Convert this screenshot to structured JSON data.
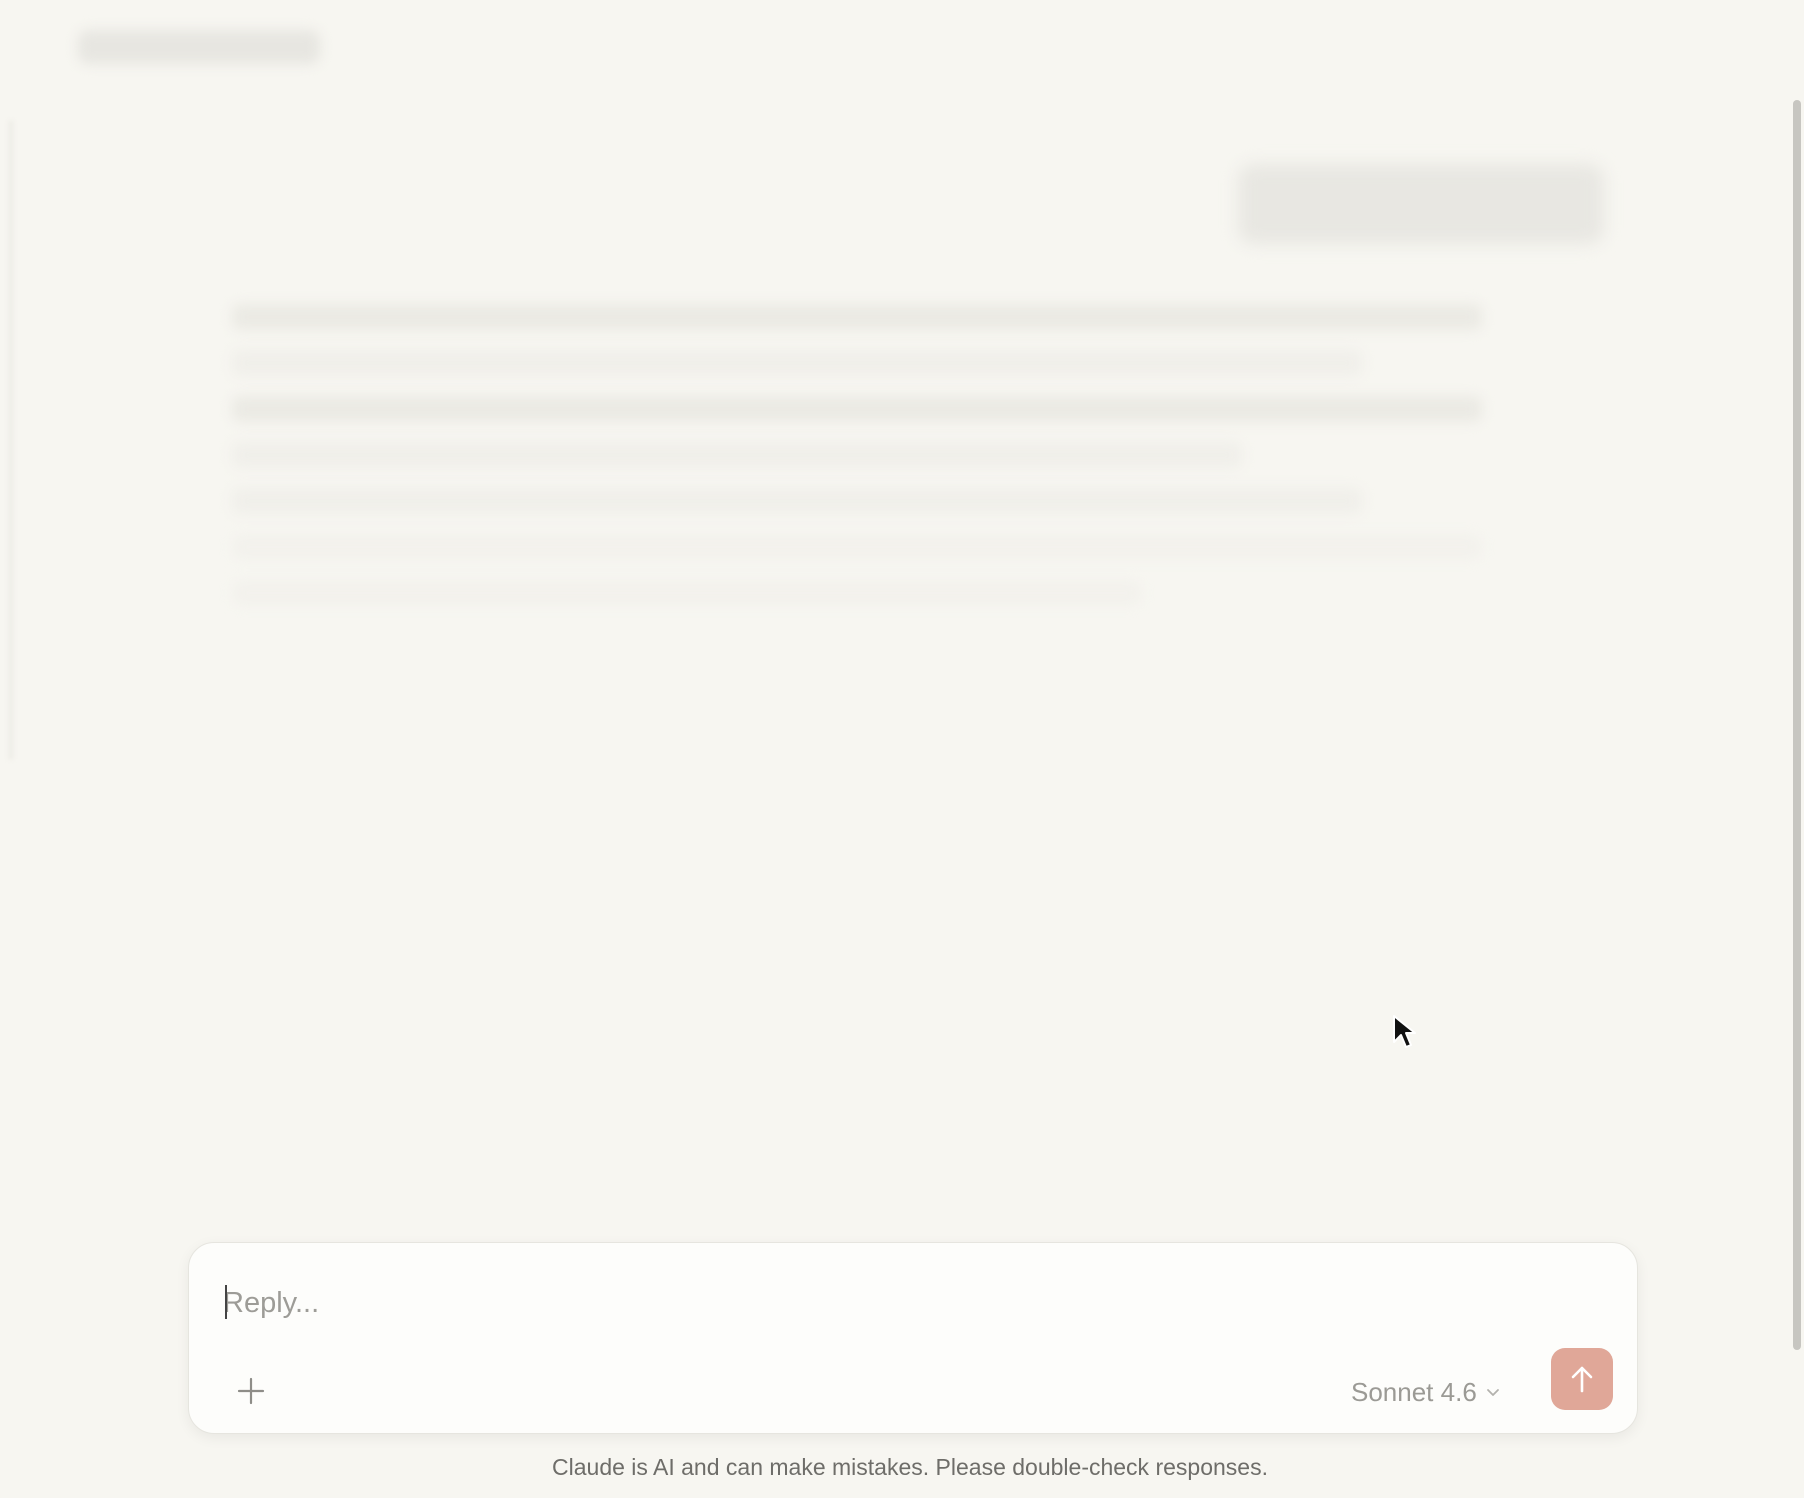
{
  "composer": {
    "placeholder": "Reply...",
    "value": "",
    "model_label": "Sonnet 4.6",
    "attach_icon": "plus-icon",
    "model_icon": "chevron-down-icon",
    "send_icon": "arrow-up-icon"
  },
  "footer": {
    "disclaimer": "Claude is AI and can make mistakes. Please double-check responses."
  },
  "colors": {
    "background": "#f7f6f1",
    "send_button": "#e0a798",
    "composer_bg": "#fdfdfb"
  }
}
